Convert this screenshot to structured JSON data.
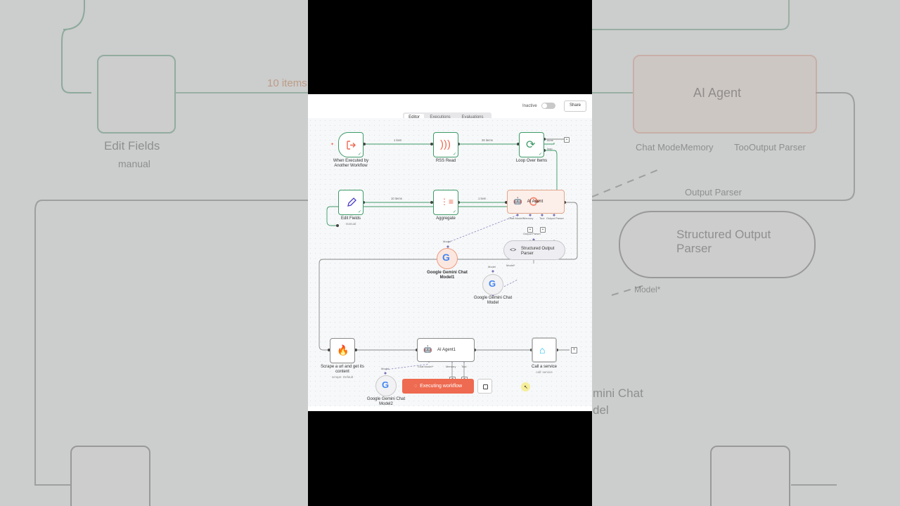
{
  "background": {
    "edit_fields_title": "Edit Fields",
    "edit_fields_sub": "manual",
    "items_label": "10 items",
    "agent_title": "AI Agent",
    "agent_ports": "Chat ModeMemory",
    "agent_ports2": "TooOutput Parser",
    "output_parser": "Output Parser",
    "structured_title": "Structured Output Parser",
    "model_label": "Model*",
    "gemini_partial": "mini Chat",
    "gemini_partial2": "del"
  },
  "header": {
    "status_label": "Inactive",
    "share_label": "Share"
  },
  "tabs": [
    {
      "label": "Editor",
      "active": true
    },
    {
      "label": "Executions",
      "active": false
    },
    {
      "label": "Evaluations",
      "active": false
    }
  ],
  "nodes": {
    "trigger": {
      "label": "When Executed by Another Workflow"
    },
    "rss": {
      "label": "RSS Read"
    },
    "loop": {
      "label": "Loop Over Items",
      "out_done": "done",
      "out_loop": "loop"
    },
    "edit": {
      "label": "Edit Fields",
      "sub": "manual"
    },
    "aggregate": {
      "label": "Aggregate"
    },
    "agent": {
      "label": "AI Agent",
      "port_chat": "Chat Model*",
      "port_memory": "Memory",
      "port_tool": "Tool",
      "port_output": "Output Parser",
      "output_parser_label": "Output Parser"
    },
    "gemini1": {
      "label": "Google Gemini Chat Model1",
      "port": "Model"
    },
    "structured": {
      "label": "Structured Output Parser",
      "port": "Model*"
    },
    "gemini": {
      "label": "Google Gemini Chat Model",
      "port": "Model"
    },
    "scrape": {
      "label": "Scrape a url and get its content",
      "sub": "scrape: Default"
    },
    "agent1": {
      "label": "AI Agent1",
      "port_chat": "Chat Model*",
      "port_memory": "Memory",
      "port_tool": "Tool"
    },
    "call": {
      "label": "Call a service",
      "sub": "call: service"
    },
    "gemini2": {
      "label": "Google Gemini Chat Model2",
      "port": "Model"
    }
  },
  "edges": {
    "e1": "1 item",
    "e2": "26 items",
    "e3": "10 items",
    "e4": "10 items",
    "e5": "1 item"
  },
  "footer": {
    "execute_label": "Executing workflow"
  },
  "colors": {
    "accent": "#ee6a50",
    "success": "#3e9a68",
    "agent_bg": "#fcefe9"
  }
}
